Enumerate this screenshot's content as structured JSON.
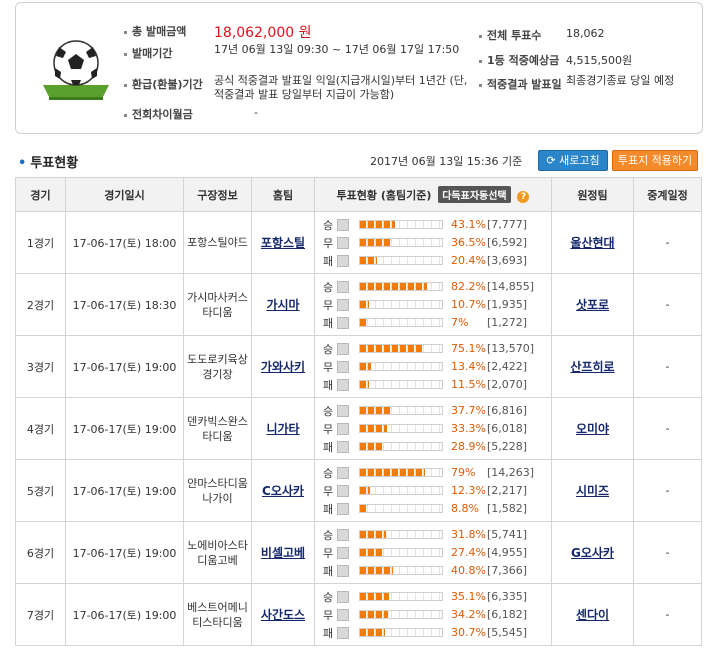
{
  "summary": {
    "total_sales_label": "총 발매금액",
    "total_sales": "18,062,000 원",
    "sale_period_label": "발매기간",
    "sale_period": "17년 06월 13일 09:30 ~ 17년 06월 17일 17:50",
    "refund_label": "환급(환불)기간",
    "refund": "공식 적중결과 발표일 익일(지급개시일)부터 1년간 (단, 적중결과 발표 당일부터 지급이 가능함)",
    "carryover_label": "전회차이월금",
    "carryover": "-",
    "total_votes_label": "전체 투표수",
    "total_votes": "18,062",
    "first_prize_label": "1등 적중예상금",
    "first_prize": "4,515,500원",
    "result_label": "적중결과 발표일",
    "result": "최종경기종료 당일 예정"
  },
  "section": {
    "title": "투표현황",
    "datetime": "2017년 06월 13일 15:36 기준",
    "refresh": "새로고침",
    "apply": "투표지 적용하기"
  },
  "table": {
    "headers": [
      "경기",
      "경기일시",
      "구장정보",
      "홈팀",
      "투표현황 (홈팀기준)",
      "원정팀",
      "중계일정"
    ],
    "auto_select": "다득표자동선택",
    "help": "?",
    "labels": [
      "승",
      "무",
      "패"
    ],
    "rows": [
      {
        "game": "1경기",
        "date": "17-06-17(토) 18:00",
        "venue": "포항스틸야드",
        "home": "포항스틸",
        "away": "울산현대",
        "broadcast": "-",
        "votes": [
          {
            "pct": "43.1%",
            "count": "[7,777]",
            "value": 43.1
          },
          {
            "pct": "36.5%",
            "count": "[6,592]",
            "value": 36.5
          },
          {
            "pct": "20.4%",
            "count": "[3,693]",
            "value": 20.4
          }
        ]
      },
      {
        "game": "2경기",
        "date": "17-06-17(토) 18:30",
        "venue": "가시마사커스타디움",
        "home": "가시마",
        "away": "삿포로",
        "broadcast": "-",
        "votes": [
          {
            "pct": "82.2%",
            "count": "[14,855]",
            "value": 82.2
          },
          {
            "pct": "10.7%",
            "count": "[1,935]",
            "value": 10.7
          },
          {
            "pct": "7%",
            "count": "[1,272]",
            "value": 7
          }
        ]
      },
      {
        "game": "3경기",
        "date": "17-06-17(토) 19:00",
        "venue": "도도로키육상경기장",
        "home": "가와사키",
        "away": "산프히로",
        "broadcast": "-",
        "votes": [
          {
            "pct": "75.1%",
            "count": "[13,570]",
            "value": 75.1
          },
          {
            "pct": "13.4%",
            "count": "[2,422]",
            "value": 13.4
          },
          {
            "pct": "11.5%",
            "count": "[2,070]",
            "value": 11.5
          }
        ]
      },
      {
        "game": "4경기",
        "date": "17-06-17(토) 19:00",
        "venue": "덴카빅스완스타디움",
        "home": "니가타",
        "away": "오미야",
        "broadcast": "-",
        "votes": [
          {
            "pct": "37.7%",
            "count": "[6,816]",
            "value": 37.7
          },
          {
            "pct": "33.3%",
            "count": "[6,018]",
            "value": 33.3
          },
          {
            "pct": "28.9%",
            "count": "[5,228]",
            "value": 28.9
          }
        ]
      },
      {
        "game": "5경기",
        "date": "17-06-17(토) 19:00",
        "venue": "얀마스타디움나가이",
        "home": "C오사카",
        "away": "시미즈",
        "broadcast": "-",
        "votes": [
          {
            "pct": "79%",
            "count": "[14,263]",
            "value": 79
          },
          {
            "pct": "12.3%",
            "count": "[2,217]",
            "value": 12.3
          },
          {
            "pct": "8.8%",
            "count": "[1,582]",
            "value": 8.8
          }
        ]
      },
      {
        "game": "6경기",
        "date": "17-06-17(토) 19:00",
        "venue": "노에비아스타디움고베",
        "home": "비셀고베",
        "away": "G오사카",
        "broadcast": "-",
        "votes": [
          {
            "pct": "31.8%",
            "count": "[5,741]",
            "value": 31.8
          },
          {
            "pct": "27.4%",
            "count": "[4,955]",
            "value": 27.4
          },
          {
            "pct": "40.8%",
            "count": "[7,366]",
            "value": 40.8
          }
        ]
      },
      {
        "game": "7경기",
        "date": "17-06-17(토) 19:00",
        "venue": "베스트어메니티스타디움",
        "home": "사간도스",
        "away": "센다이",
        "broadcast": "-",
        "votes": [
          {
            "pct": "35.1%",
            "count": "[6,335]",
            "value": 35.1
          },
          {
            "pct": "34.2%",
            "count": "[6,182]",
            "value": 34.2
          },
          {
            "pct": "30.7%",
            "count": "[5,545]",
            "value": 30.7
          }
        ]
      }
    ]
  }
}
